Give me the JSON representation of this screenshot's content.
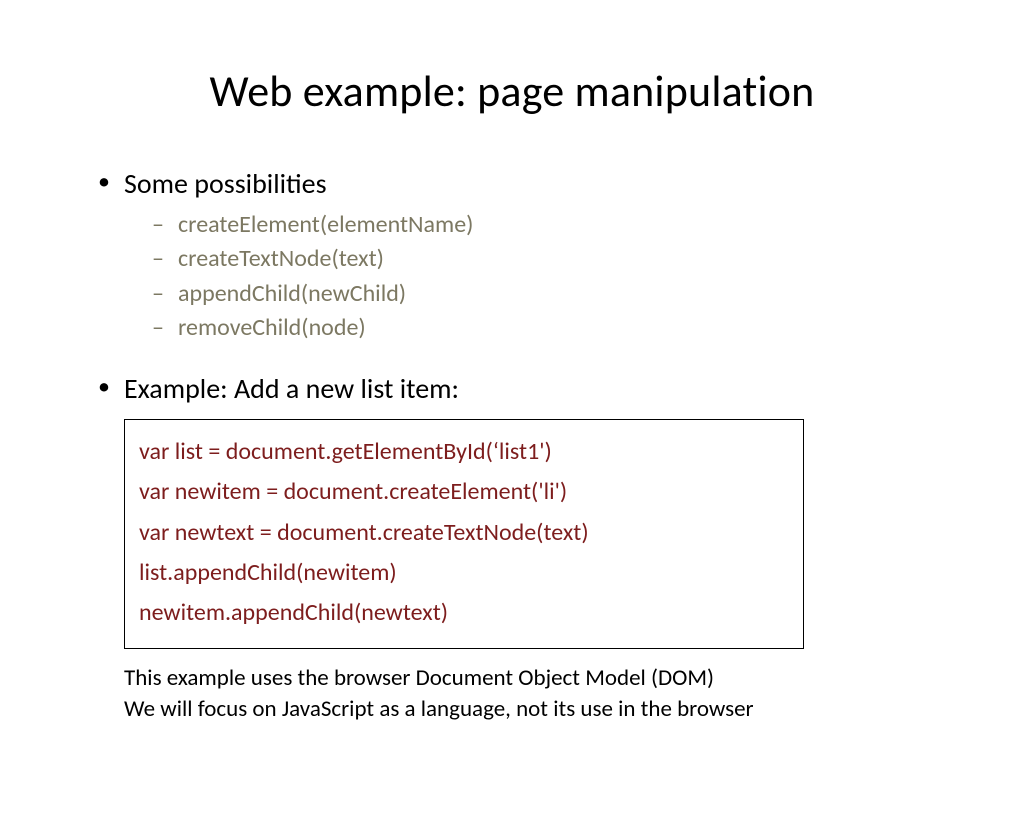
{
  "title": "Web example: page manipulation",
  "bullets": {
    "item1": "Some possibilities",
    "sub": {
      "a": "createElement(elementName)",
      "b": "createTextNode(text)",
      "c": "appendChild(newChild)",
      "d": "removeChild(node)"
    },
    "item2": "Example: Add a new list item:"
  },
  "code": {
    "l1": "var list = document.getElementById(‘list1')",
    "l2": "var newitem = document.createElement('li')",
    "l3": "var newtext = document.createTextNode(text)",
    "l4": "list.appendChild(newitem)",
    "l5": "newitem.appendChild(newtext)"
  },
  "footnote": {
    "l1": "This example uses the browser Document Object Model (DOM)",
    "l2": "We will focus on JavaScript as a language, not its use in the browser"
  }
}
